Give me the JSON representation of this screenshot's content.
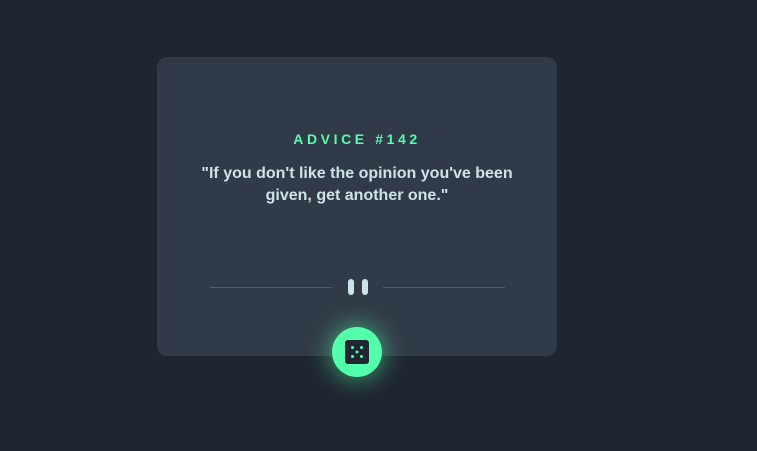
{
  "card": {
    "advice_label": "ADVICE #142",
    "quote": "\"If you don't like the opinion you've been given, get another one.\""
  },
  "divider": {
    "icon": "pause-icon"
  },
  "dice_button": {
    "icon": "dice-icon"
  },
  "colors": {
    "background": "#1f2631",
    "card": "#313a48",
    "accent": "#53ffaa",
    "text": "#cee3e9",
    "divider": "#4f5d74"
  }
}
